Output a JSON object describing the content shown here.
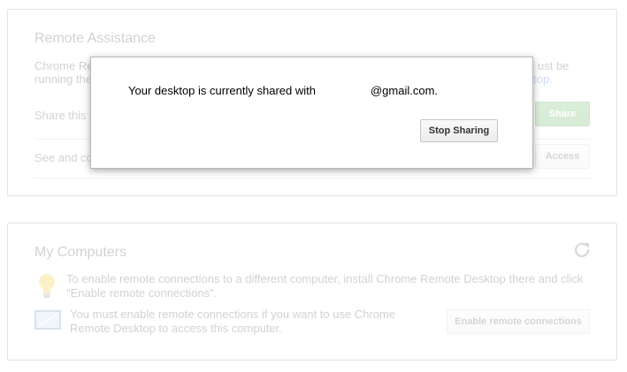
{
  "remote_assistance": {
    "title": "Remote Assistance",
    "desc_line1_start": "Chrome Re",
    "desc_line1_end": "ust be",
    "desc_line2_start": "running the",
    "desc_line2_link_end": "top.",
    "share_text": "Share this c",
    "share_button": "Share",
    "see_text": "See and co",
    "access_button": "Access"
  },
  "my_computers": {
    "title": "My Computers",
    "tip_text": "To enable remote connections to a different computer, install Chrome Remote Desktop there and click \"Enable remote connections\".",
    "enable_text": "You must enable remote connections if you want to use Chrome Remote Desktop to access this computer.",
    "enable_button": "Enable remote connections"
  },
  "dialog": {
    "message_prefix": "Your desktop is currently shared with",
    "message_email_suffix": "@gmail.com.",
    "stop_button": "Stop Sharing"
  },
  "icons": {
    "lightbulb": "lightbulb-icon",
    "monitor": "monitor-icon",
    "refresh": "refresh-icon"
  },
  "colors": {
    "accent_green": "#4aa64a",
    "link_blue": "#1155cc"
  }
}
